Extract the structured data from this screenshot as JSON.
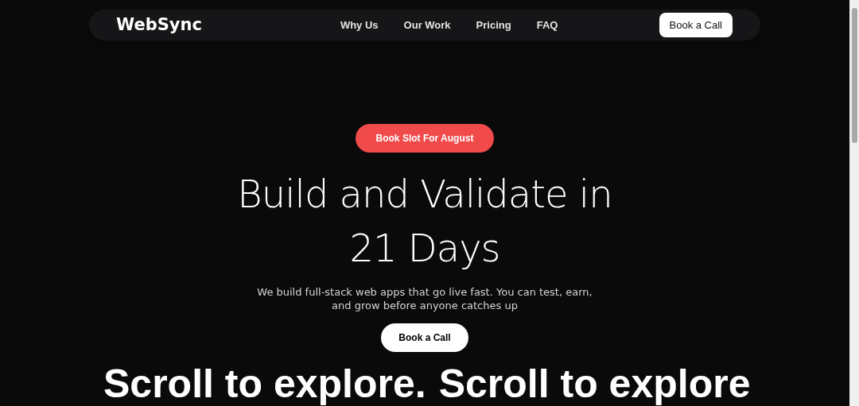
{
  "nav": {
    "logo": "WebSync",
    "links": [
      "Why Us",
      "Our Work",
      "Pricing",
      "FAQ"
    ],
    "cta": "Book a Call"
  },
  "hero": {
    "badge": "Book Slot For August",
    "title_lines": [
      "Build and Validate in",
      "21 Days"
    ],
    "subtitle": "We build full-stack web apps that go live fast. You can test, earn, and grow before anyone catches up",
    "cta": "Book a Call"
  },
  "marquee": [
    "Scroll to explore.",
    "Scroll to explore"
  ]
}
